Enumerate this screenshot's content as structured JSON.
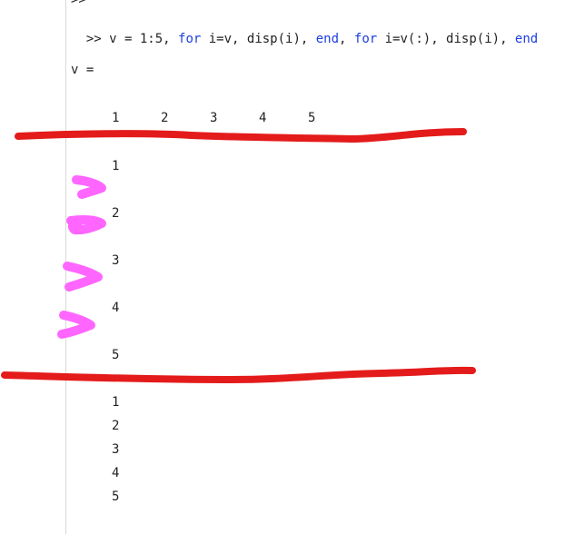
{
  "command_window": {
    "partial_top_prompt": ">>",
    "command": {
      "prompt": ">>",
      "part1": " v = 1:5, ",
      "kw_for1": "for",
      "part2": " i=v, disp(i), ",
      "kw_end1": "end",
      "part3": ", ",
      "kw_for2": "for",
      "part4": " i=v(:), disp(i), ",
      "kw_end2": "end"
    },
    "var_label": "v =",
    "v_values": [
      "1",
      "2",
      "3",
      "4",
      "5"
    ],
    "first_loop_output": [
      "1",
      "2",
      "3",
      "4",
      "5"
    ],
    "second_loop_output": [
      "1",
      "2",
      "3",
      "4",
      "5"
    ]
  },
  "colors": {
    "keyword": "#1b3ee0",
    "text": "#222222",
    "red_annotation": "#e41b1b",
    "pink_annotation": "#ff66ff"
  },
  "annotations": {
    "red_underlines": 2,
    "pink_arrow_marks": 4
  }
}
